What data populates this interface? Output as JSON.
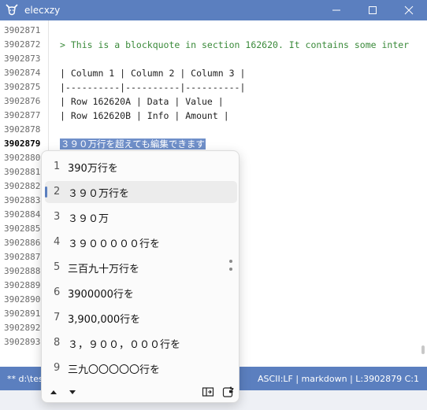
{
  "window": {
    "title": "elecxzy",
    "icon": "goat-logo-icon"
  },
  "gutter": {
    "lines": [
      "3902871",
      "3902872",
      "3902873",
      "3902874",
      "3902875",
      "3902876",
      "3902877",
      "3902878",
      "3902879",
      "3902880",
      "3902881",
      "3902882",
      "3902883",
      "3902884",
      "3902885",
      "3902886",
      "3902887",
      "3902888",
      "3902889",
      "3902890",
      "3902891",
      "3902892",
      "3902893"
    ],
    "current_line": "3902879"
  },
  "editor": {
    "lines": [
      "",
      "> This is a blockquote in section 162620. It contains some inter",
      "",
      "| Column 1 | Column 2 | Column 3 |",
      "|----------|----------|----------|",
      "| Row 162620A | Data | Value |",
      "| Row 162620B | Info | Amount |",
      "",
      "３９０万行を超えても編集できます"
    ]
  },
  "ime": {
    "candidates": [
      {
        "num": "1",
        "text": "390万行を"
      },
      {
        "num": "2",
        "text": "３９０万行を"
      },
      {
        "num": "3",
        "text": "３９０万"
      },
      {
        "num": "4",
        "text": "３９０００００行を"
      },
      {
        "num": "5",
        "text": "三百九十万行を"
      },
      {
        "num": "6",
        "text": "3900000行を"
      },
      {
        "num": "7",
        "text": "3,900,000行を"
      },
      {
        "num": "8",
        "text": "３，９００，０００行を"
      },
      {
        "num": "9",
        "text": "三九〇〇〇〇〇行を"
      }
    ],
    "selected_index": 1
  },
  "statusbar": {
    "left": "** d:\\tes",
    "right": "ASCII:LF | markdown | L:3902879 C:1"
  },
  "colors": {
    "accent": "#5b7fbf",
    "selection": "#6f8fc9",
    "quote_text": "#3a8a3a"
  }
}
